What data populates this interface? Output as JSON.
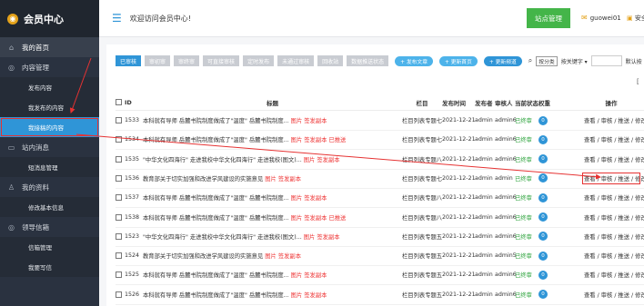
{
  "sidebar": {
    "title": "会员中心",
    "items": [
      {
        "label": "我的首页",
        "icon": "home-icon"
      },
      {
        "label": "内容管理",
        "icon": "target-icon"
      },
      {
        "label": "发布内容"
      },
      {
        "label": "我发布的内容"
      },
      {
        "label": "我接稿的内容"
      },
      {
        "label": "站内消息",
        "icon": "message-icon"
      },
      {
        "label": "短消息管理"
      },
      {
        "label": "我的资料",
        "icon": "user-icon"
      },
      {
        "label": "修改基本信息"
      },
      {
        "label": "领导信箱",
        "icon": "target-icon"
      },
      {
        "label": "信箱管理"
      },
      {
        "label": "我要写信"
      }
    ]
  },
  "header": {
    "welcome": "欢迎访问会员中心!",
    "site_button": "站点管理",
    "username": "guowei01",
    "safe_exit": "安全退出"
  },
  "filters": {
    "tabs": [
      "已审核",
      "审初审",
      "审终审",
      "可直接审核",
      "定时发布",
      "未通过审核",
      "回收站",
      "数据推送状态"
    ],
    "buttons": [
      "+ 发布文章",
      "+ 更新首页",
      "+ 更新频道"
    ],
    "sort_label": "按分类",
    "keyword_label": "按关键字",
    "default_label": "默认按"
  },
  "table": {
    "headers": {
      "id": "ID",
      "title": "标题",
      "column": "栏目",
      "time": "发布时间",
      "publisher": "发布者",
      "reviewer": "审核人",
      "status": "当前状态",
      "weight": "权重",
      "operation": "操作"
    },
    "rows": [
      {
        "id": "1533",
        "title": "本科就有导师 岳麓书院制度做成了\"温度\" 岳麓书院制度...",
        "tags": "图片 签发副本",
        "column": "栏目列表专题七",
        "time": "2021-12-21",
        "pub": "admin",
        "rev": "admin6",
        "status": "已终审",
        "weight": "0",
        "ops": "查看 / 审核 / 推送 / 修改 /"
      },
      {
        "id": "1534",
        "title": "本科就有导师 岳麓书院制度做成了\"温度\" 岳麓书院制度...",
        "tags": "图片 签发副本 已推送",
        "column": "栏目列表专题七",
        "time": "2021-12-21",
        "pub": "admin",
        "rev": "admin6",
        "status": "已终审",
        "weight": "0",
        "ops": "查看 / 审核 / 推送 / 修改 /"
      },
      {
        "id": "1535",
        "title": "\"中华文化四海行\" 走进我校中华文化四海行\" 走进我校(图文)...",
        "tags": "图片 签发副本",
        "column": "栏目列表专题八",
        "time": "2021-12-21",
        "pub": "admin",
        "rev": "admin6",
        "status": "已终审",
        "weight": "0",
        "ops": "查看 / 审核 / 推送 / 修改 /"
      },
      {
        "id": "1536",
        "title": "教育部关于切实加强和改进学风建设的实施意见",
        "tags": "图片 签发副本",
        "column": "栏目列表专题七",
        "time": "2021-12-21",
        "pub": "admin",
        "rev": "admin",
        "status": "已终审",
        "weight": "0",
        "ops": "查看 / 审核 / 推送 / 修改 /"
      },
      {
        "id": "1537",
        "title": "本科就有导师 岳麓书院制度做成了\"温度\" 岳麓书院制度...",
        "tags": "图片 签发副本",
        "column": "栏目列表专题八",
        "time": "2021-12-21",
        "pub": "admin",
        "rev": "admin6",
        "status": "已终审",
        "weight": "0",
        "ops": "查看 / 审核 / 推送 / 修改 /"
      },
      {
        "id": "1538",
        "title": "本科就有导师 岳麓书院制度做成了\"温度\" 岳麓书院制度...",
        "tags": "图片 签发副本 已推送",
        "column": "栏目列表专题八",
        "time": "2021-12-21",
        "pub": "admin",
        "rev": "admin6",
        "status": "已终审",
        "weight": "0",
        "ops": "查看 / 审核 / 推送 / 修改 /"
      },
      {
        "id": "1523",
        "title": "\"中华文化四海行\" 走进我校中华文化四海行\" 走进我校(图文)...",
        "tags": "图片 签发副本",
        "column": "栏目列表专题五",
        "time": "2021-12-21",
        "pub": "admin",
        "rev": "admin6",
        "status": "已终审",
        "weight": "0",
        "ops": "查看 / 审核 / 推送 / 修改 /"
      },
      {
        "id": "1524",
        "title": "教育部关于切实加强和改进学风建设的实施意见",
        "tags": "图片 签发副本",
        "column": "栏目列表专题五",
        "time": "2021-12-21",
        "pub": "admin",
        "rev": "admin5",
        "status": "已终审",
        "weight": "0",
        "ops": "查看 / 审核 / 推送 / 修改 /"
      },
      {
        "id": "1525",
        "title": "本科就有导师 岳麓书院制度做成了\"温度\" 岳麓书院制度...",
        "tags": "图片 签发副本",
        "column": "栏目列表专题五",
        "time": "2021-12-21",
        "pub": "admin",
        "rev": "admin6",
        "status": "已终审",
        "weight": "0",
        "ops": "查看 / 审核 / 推送 / 修改 /"
      },
      {
        "id": "1526",
        "title": "本科就有导师 岳麓书院制度做成了\"温度\" 岳麓书院制度...",
        "tags": "图片 签发副本",
        "column": "栏目列表专题五",
        "time": "2021-12-21",
        "pub": "admin",
        "rev": "admin6",
        "status": "已终审",
        "weight": "0",
        "ops": "查看 / 审核 / 推送 / 修改 /"
      }
    ]
  },
  "colors": {
    "accent": "#2f95d7",
    "sidebar": "#2a3240",
    "success": "#44b549",
    "annotation": "#e63232"
  }
}
